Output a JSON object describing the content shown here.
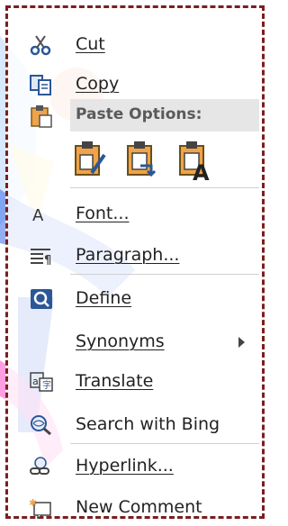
{
  "menu": {
    "items": [
      {
        "label": "Cut",
        "icon": "scissors-icon"
      },
      {
        "label": "Copy",
        "icon": "copy-icon"
      },
      {
        "label": "Paste Options:",
        "icon": "paste-icon"
      },
      {
        "label": "Font...",
        "icon": "font-icon"
      },
      {
        "label": "Paragraph...",
        "icon": "paragraph-icon"
      },
      {
        "label": "Define",
        "icon": "define-icon"
      },
      {
        "label": "Synonyms",
        "icon": ""
      },
      {
        "label": "Translate",
        "icon": "translate-icon"
      },
      {
        "label": "Search with Bing",
        "icon": "search-bing-icon"
      },
      {
        "label": "Hyperlink...",
        "icon": "hyperlink-icon"
      },
      {
        "label": "New Comment",
        "icon": "new-comment-icon"
      }
    ],
    "paste_options": [
      {
        "icon": "paste-keep-formatting-icon"
      },
      {
        "icon": "paste-merge-formatting-icon"
      },
      {
        "icon": "paste-text-only-icon"
      }
    ]
  },
  "colors": {
    "border": "#7b1e1e",
    "header_bg": "#e6e6e6",
    "icon_blue": "#2b5797",
    "icon_orange": "#f0a34a"
  }
}
